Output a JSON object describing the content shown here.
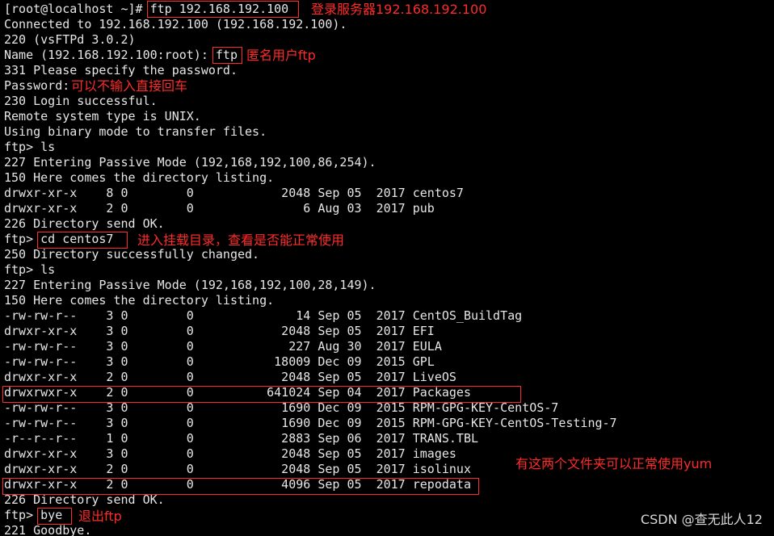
{
  "terminal": {
    "lines": [
      "[root@localhost ~]# ftp 192.168.192.100",
      "Connected to 192.168.192.100 (192.168.192.100).",
      "220 (vsFTPd 3.0.2)",
      "Name (192.168.192.100:root): ftp",
      "331 Please specify the password.",
      "Password:",
      "230 Login successful.",
      "Remote system type is UNIX.",
      "Using binary mode to transfer files.",
      "ftp> ls",
      "227 Entering Passive Mode (192,168,192,100,86,254).",
      "150 Here comes the directory listing.",
      "drwxr-xr-x    8 0        0            2048 Sep 05  2017 centos7",
      "drwxr-xr-x    2 0        0               6 Aug 03  2017 pub",
      "226 Directory send OK.",
      "ftp> cd centos7",
      "250 Directory successfully changed.",
      "ftp> ls",
      "227 Entering Passive Mode (192,168,192,100,28,149).",
      "150 Here comes the directory listing.",
      "-rw-rw-r--    3 0        0              14 Sep 05  2017 CentOS_BuildTag",
      "drwxr-xr-x    3 0        0            2048 Sep 05  2017 EFI",
      "-rw-rw-r--    3 0        0             227 Aug 30  2017 EULA",
      "-rw-rw-r--    3 0        0           18009 Dec 09  2015 GPL",
      "drwxr-xr-x    2 0        0            2048 Sep 05  2017 LiveOS",
      "drwxrwxr-x    2 0        0          641024 Sep 04  2017 Packages",
      "-rw-rw-r--    3 0        0            1690 Dec 09  2015 RPM-GPG-KEY-CentOS-7",
      "-rw-rw-r--    3 0        0            1690 Dec 09  2015 RPM-GPG-KEY-CentOS-Testing-7",
      "-r--r--r--    1 0        0            2883 Sep 06  2017 TRANS.TBL",
      "drwxr-xr-x    3 0        0            2048 Sep 05  2017 images",
      "drwxr-xr-x    2 0        0            2048 Sep 05  2017 isolinux",
      "drwxr-xr-x    2 0        0            4096 Sep 05  2017 repodata",
      "226 Directory send OK.",
      "ftp> bye",
      "221 Goodbye."
    ]
  },
  "annotations": {
    "login": "登录服务器192.168.192.100",
    "anon_user": "匿名用户ftp",
    "no_password": "可以不输入直接回车",
    "cd_mount": "进入挂载目录，查看是否能正常使用",
    "yum_folders": "有这两个文件夹可以正常使用yum",
    "exit": "退出ftp"
  },
  "watermark": "CSDN @查无此人12",
  "colors": {
    "background": "#000000",
    "text": "#e6e6e6",
    "annotation": "#ff2a2a"
  }
}
